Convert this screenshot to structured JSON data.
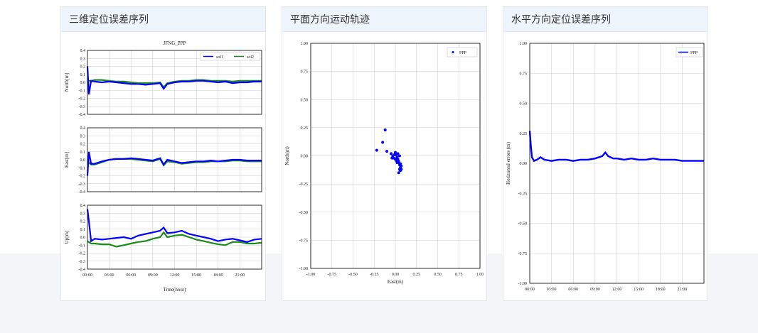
{
  "cards": [
    {
      "title": "三维定位误差序列"
    },
    {
      "title": "平面方向运动轨迹"
    },
    {
      "title": "水平方向定位误差序列"
    }
  ],
  "colors": {
    "accent_blue": "#0000ff",
    "accent_green": "#1a8a1a",
    "header_bg": "#edf4fb"
  },
  "chart_data": [
    {
      "type": "line",
      "title": "JFNG_PPP",
      "xlabel": "Time(hour)",
      "x_ticks": [
        "00:00",
        "03:00",
        "06:00",
        "09:00",
        "12:00",
        "15:00",
        "18:00",
        "21:00"
      ],
      "y_ticks": [
        "0.4",
        "0.3",
        "0.2",
        "0.1",
        "0.0",
        "-0.1",
        "-0.2",
        "-0.3",
        "-0.4"
      ],
      "ylim": [
        -0.4,
        0.4
      ],
      "legend": [
        "sol1",
        "sol2"
      ],
      "subplots": [
        {
          "ylabel": "North[m]",
          "series": [
            {
              "name": "sol1",
              "x": [
                0,
                0.2,
                0.5,
                1,
                2,
                3,
                4,
                5,
                6,
                7,
                8,
                9,
                10,
                10.5,
                11,
                12,
                13,
                14,
                15,
                16,
                17,
                18,
                19,
                20,
                21,
                22,
                23,
                24
              ],
              "y": [
                0.2,
                -0.15,
                0.02,
                0.01,
                0.0,
                0.01,
                0.0,
                -0.01,
                -0.02,
                -0.02,
                -0.03,
                -0.02,
                -0.01,
                -0.08,
                -0.02,
                0.0,
                0.01,
                0.01,
                0.02,
                0.02,
                0.01,
                0.0,
                0.01,
                -0.01,
                0.0,
                0.0,
                0.01,
                0.01
              ]
            },
            {
              "name": "sol2",
              "x": [
                0,
                0.5,
                1,
                2,
                3,
                4,
                5,
                6,
                7,
                8,
                9,
                10,
                10.5,
                11,
                12,
                13,
                14,
                15,
                16,
                17,
                18,
                19,
                20,
                21,
                22,
                23,
                24
              ],
              "y": [
                0.02,
                0.02,
                0.03,
                0.03,
                0.02,
                0.01,
                0.01,
                0.0,
                -0.01,
                -0.01,
                -0.01,
                0.0,
                -0.06,
                -0.01,
                0.01,
                0.02,
                0.02,
                0.03,
                0.03,
                0.02,
                0.02,
                0.02,
                0.01,
                0.02,
                0.02,
                0.02,
                0.02
              ]
            }
          ]
        },
        {
          "ylabel": "East[m]",
          "series": [
            {
              "name": "sol1",
              "x": [
                0,
                0.2,
                0.5,
                1,
                2,
                3,
                4,
                5,
                6,
                7,
                8,
                9,
                10,
                10.5,
                11,
                12,
                13,
                14,
                15,
                16,
                17,
                18,
                19,
                20,
                21,
                22,
                23,
                24
              ],
              "y": [
                -0.2,
                0.1,
                -0.05,
                -0.05,
                -0.02,
                0.0,
                0.01,
                0.01,
                0.02,
                0.01,
                0.0,
                -0.01,
                0.02,
                -0.06,
                0.0,
                -0.02,
                -0.04,
                -0.03,
                -0.02,
                -0.02,
                -0.01,
                -0.02,
                -0.01,
                0.0,
                0.0,
                -0.01,
                -0.01,
                -0.01
              ]
            },
            {
              "name": "sol2",
              "x": [
                0,
                0.5,
                1,
                2,
                3,
                4,
                5,
                6,
                7,
                8,
                9,
                10,
                10.5,
                11,
                12,
                13,
                14,
                15,
                16,
                17,
                18,
                19,
                20,
                21,
                22,
                23,
                24
              ],
              "y": [
                -0.02,
                -0.06,
                -0.06,
                -0.03,
                0.0,
                0.01,
                0.01,
                0.01,
                0.0,
                -0.01,
                -0.02,
                0.01,
                -0.07,
                -0.02,
                -0.03,
                -0.05,
                -0.04,
                -0.03,
                -0.03,
                -0.02,
                -0.02,
                -0.02,
                -0.01,
                -0.01,
                -0.02,
                -0.02,
                -0.02
              ]
            }
          ]
        },
        {
          "ylabel": "Up[m]",
          "series": [
            {
              "name": "sol1",
              "x": [
                0,
                0.2,
                0.5,
                1,
                2,
                3,
                4,
                5,
                6,
                7,
                8,
                9,
                10,
                10.5,
                11,
                12,
                13,
                14,
                15,
                16,
                17,
                18,
                19,
                20,
                21,
                22,
                23,
                24
              ],
              "y": [
                0.35,
                0.2,
                -0.05,
                -0.02,
                -0.03,
                -0.02,
                -0.01,
                0.0,
                -0.02,
                0.02,
                0.04,
                0.06,
                0.08,
                0.12,
                0.05,
                0.06,
                0.08,
                0.04,
                0.02,
                0.0,
                -0.02,
                -0.05,
                -0.03,
                -0.02,
                -0.04,
                -0.06,
                -0.03,
                -0.02
              ]
            },
            {
              "name": "sol2",
              "x": [
                0,
                0.5,
                1,
                2,
                3,
                4,
                5,
                6,
                7,
                8,
                9,
                10,
                10.5,
                11,
                12,
                13,
                14,
                15,
                16,
                17,
                18,
                19,
                20,
                21,
                22,
                23,
                24
              ],
              "y": [
                -0.05,
                -0.08,
                -0.08,
                -0.09,
                -0.09,
                -0.12,
                -0.1,
                -0.08,
                -0.06,
                -0.05,
                -0.02,
                0.0,
                0.06,
                0.0,
                0.02,
                0.03,
                0.0,
                -0.03,
                -0.05,
                -0.07,
                -0.09,
                -0.1,
                -0.06,
                -0.06,
                -0.08,
                -0.08,
                -0.07
              ]
            }
          ]
        }
      ]
    },
    {
      "type": "scatter",
      "xlabel": "East(m)",
      "ylabel": "North(m)",
      "xlim": [
        -1.0,
        1.0
      ],
      "ylim": [
        -1.0,
        1.0
      ],
      "x_ticks": [
        "-1.00",
        "-0.75",
        "-0.50",
        "-0.25",
        "0.00",
        "0.25",
        "0.50",
        "0.75",
        "1.00"
      ],
      "y_ticks": [
        "1.00",
        "0.75",
        "0.50",
        "0.25",
        "0.00",
        "-0.25",
        "-0.50",
        "-0.75",
        "-1.00"
      ],
      "legend": [
        "PPP"
      ],
      "series": [
        {
          "name": "PPP",
          "x": [
            -0.12,
            -0.15,
            -0.22,
            -0.1,
            -0.05,
            -0.03,
            -0.02,
            0.0,
            0.01,
            0.02,
            0.03,
            0.04,
            0.05,
            0.06,
            0.07,
            0.03,
            0.05,
            0.02,
            0.04,
            0.06,
            0.0,
            0.01,
            0.03,
            -0.04,
            -0.01,
            0.02,
            0.05,
            0.07,
            0.04,
            0.06
          ],
          "y": [
            0.23,
            0.12,
            0.05,
            0.04,
            0.02,
            0.0,
            -0.02,
            -0.03,
            0.01,
            -0.01,
            -0.04,
            -0.06,
            -0.08,
            -0.1,
            -0.12,
            0.02,
            0.0,
            -0.02,
            -0.05,
            -0.07,
            0.03,
            -0.04,
            -0.03,
            -0.02,
            0.01,
            -0.06,
            -0.12,
            -0.09,
            -0.15,
            -0.13
          ]
        }
      ]
    },
    {
      "type": "line",
      "ylabel": "Horizontal errors (m)",
      "ylim": [
        -1.0,
        1.0
      ],
      "x_ticks": [
        "00:00",
        "03:00",
        "06:00",
        "09:00",
        "12:00",
        "15:00",
        "18:00",
        "21:00"
      ],
      "y_ticks": [
        "1.00",
        "0.75",
        "0.50",
        "0.25",
        "0.00",
        "-0.25",
        "-0.50",
        "-0.75",
        "-1.00"
      ],
      "legend": [
        "PPP"
      ],
      "series": [
        {
          "name": "PPP",
          "x": [
            0,
            0.15,
            0.3,
            0.6,
            1,
            1.5,
            2,
            3,
            4,
            5,
            6,
            7,
            8,
            9,
            10,
            10.4,
            10.8,
            11.5,
            12,
            13,
            14,
            15,
            16,
            17,
            18,
            19,
            20,
            21,
            22,
            23,
            24
          ],
          "y": [
            0.27,
            0.15,
            0.05,
            0.02,
            0.03,
            0.05,
            0.03,
            0.02,
            0.03,
            0.03,
            0.02,
            0.03,
            0.03,
            0.04,
            0.06,
            0.09,
            0.06,
            0.04,
            0.04,
            0.03,
            0.04,
            0.03,
            0.03,
            0.04,
            0.03,
            0.03,
            0.03,
            0.02,
            0.02,
            0.02,
            0.02
          ]
        }
      ]
    }
  ]
}
